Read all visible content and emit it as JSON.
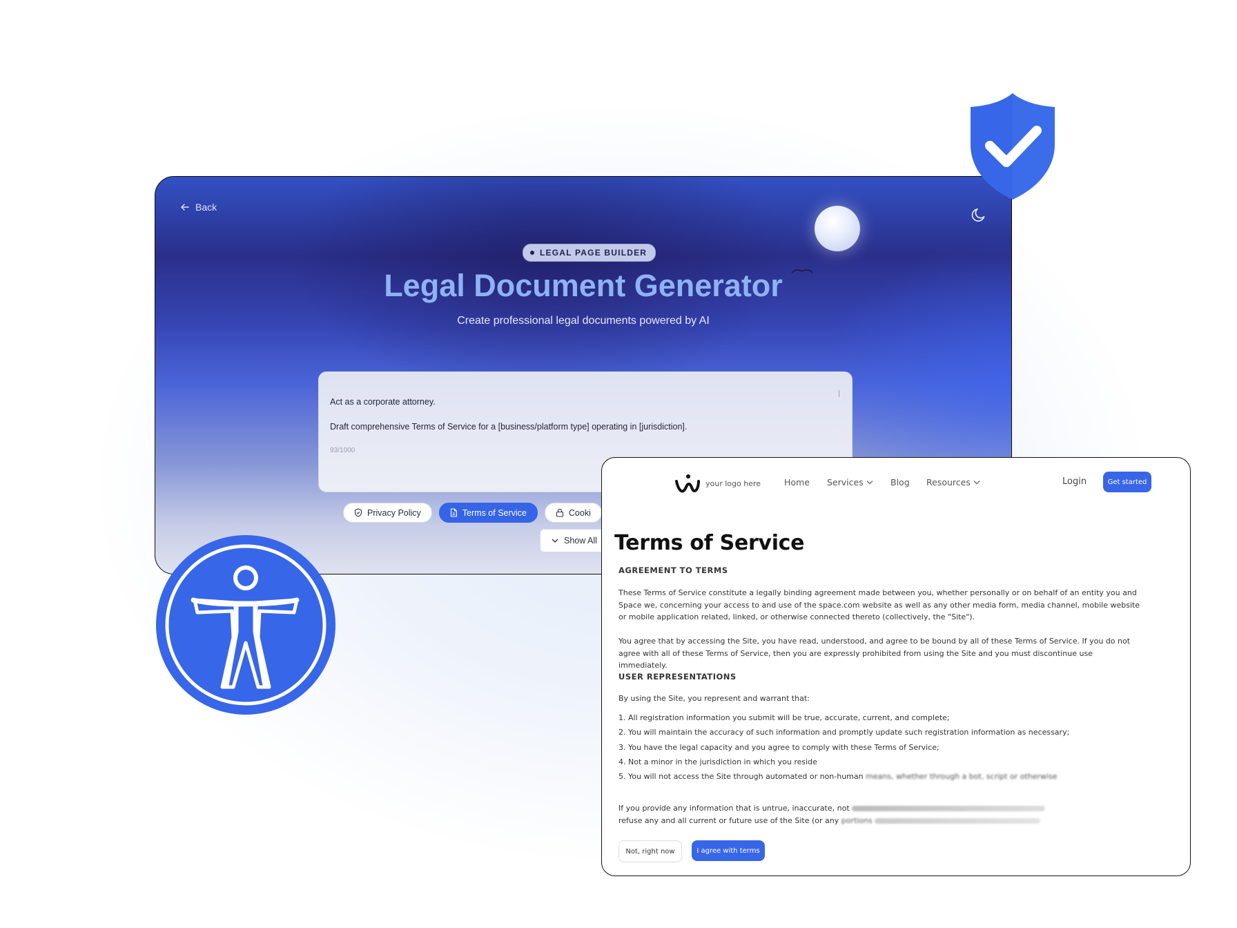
{
  "generator": {
    "back_label": "Back",
    "badge": "LEGAL PAGE BUILDER",
    "title": "Legal Document Generator",
    "subtitle": "Create professional legal documents powered by AI",
    "prompt_line1": "Act as a corporate attorney.",
    "prompt_line2": "Draft comprehensive Terms of Service for a [business/platform type] operating in [jurisdiction].",
    "char_count": "93/1000",
    "chips": [
      {
        "label": "Privacy Policy",
        "icon": "shield-icon"
      },
      {
        "label": "Terms of Service",
        "icon": "document-icon",
        "active": true
      },
      {
        "label": "Cooki",
        "icon": "lock-icon"
      }
    ],
    "show_all_label": "Show All",
    "accent_color": "#3564e6"
  },
  "tos_page": {
    "logo_text": "your logo here",
    "nav": {
      "home": "Home",
      "services": "Services",
      "blog": "Blog",
      "resources": "Resources",
      "login": "Login",
      "get_started": "Get started"
    },
    "title": "Terms of Service",
    "section1_heading": "AGREEMENT TO TERMS",
    "para1": "These Terms of Service constitute a legally binding agreement made between you, whether personally or on behalf of an entity you and Space we, concerning your access to and use of the space.com website as well as any other media form, media channel, mobile website or mobile application related, linked, or otherwise connected thereto (collectively, the \"Site\").",
    "para2": "You agree that by accessing the Site, you have read, understood, and agree to be bound by all of these Terms of Service. If you do not agree with all of these Terms of Service, then you are expressly prohibited from using the Site and you must discontinue use immediately.",
    "section2_heading": "USER REPRESENTATIONS",
    "intro": "By using the Site, you represent and warrant that:",
    "items": [
      "1. All registration information you submit will be true, accurate, current, and complete;",
      "2. You will maintain the accuracy of such information and promptly update such registration information as necessary;",
      "3. You have the legal capacity and you agree to comply with these Terms of Service;",
      "4. Not a minor in the jurisdiction in which you reside"
    ],
    "item5_visible": "5. You will not access the Site through automated or non-human ",
    "item5_blurred": "means, whether through a bot, script or otherwise",
    "para3_line1_visible": "If you provide any information that is untrue, inaccurate, not ",
    "para3_line2_visible": "refuse any and all current or future use of the Site (or any ",
    "para3_line2_blurred": "portions",
    "decline_label": "Not, right now",
    "accept_label": "I agree with terms",
    "accent_color": "#3866e8"
  }
}
